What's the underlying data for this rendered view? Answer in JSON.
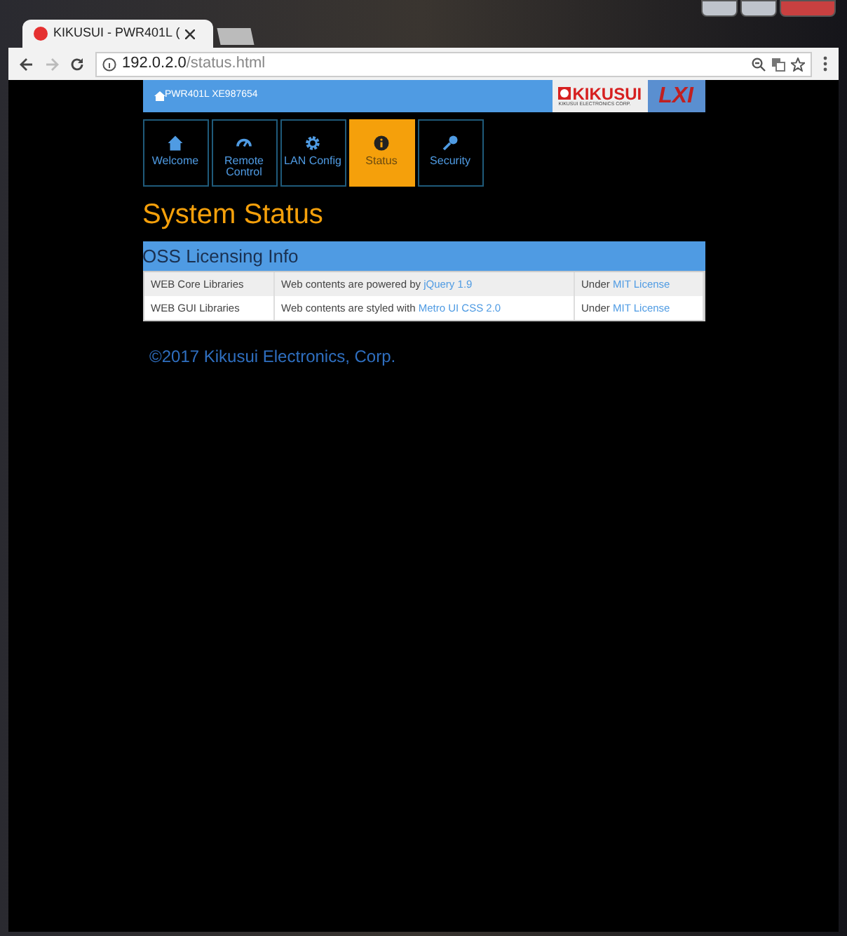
{
  "browser": {
    "tab_title": "KIKUSUI - PWR401L (",
    "host": "192.0.2.0",
    "path": "/status.html"
  },
  "header": {
    "device": "PWR401L XE987654",
    "brand": "KIKUSUI",
    "brand_sub": "KIKUSUI ELECTRONICS CORP.",
    "lxi": "LXI"
  },
  "nav": [
    {
      "kind": "home",
      "label": "Welcome",
      "selected": false
    },
    {
      "kind": "gauge",
      "label": "Remote Control",
      "selected": false
    },
    {
      "kind": "gear",
      "label": "LAN Config",
      "selected": false
    },
    {
      "kind": "info",
      "label": "Status",
      "selected": true
    },
    {
      "kind": "key",
      "label": "Security",
      "selected": false
    }
  ],
  "title": "System Status",
  "panel": {
    "title": "OSS Licensing Info",
    "rows": [
      {
        "name": "WEB Core Libraries",
        "text": "Web contents are powered by ",
        "link": "jQuery 1.9",
        "license_text": "Under ",
        "license_link": "MIT License"
      },
      {
        "name": "WEB GUI Libraries",
        "text": "Web contents are styled with ",
        "link": "Metro UI CSS 2.0",
        "license_text": "Under ",
        "license_link": "MIT License"
      }
    ]
  },
  "footer": "©2017 Kikusui Electronics, Corp."
}
